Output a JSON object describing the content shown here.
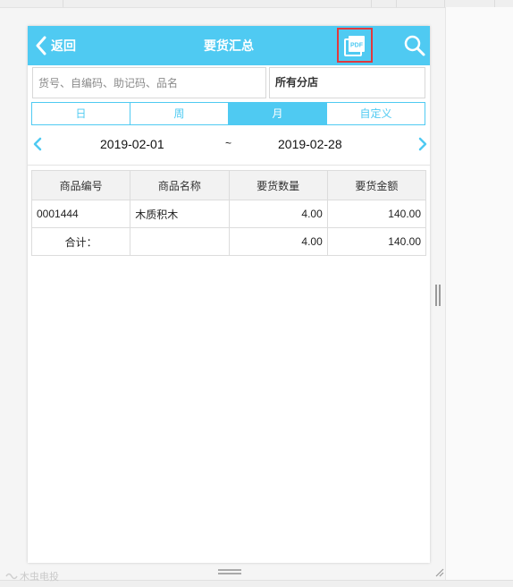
{
  "header": {
    "back_label": "返回",
    "title": "要货汇总",
    "pdf_icon": "pdf-export-icon",
    "search_icon": "search-icon",
    "pdf_text": "PDF"
  },
  "filters": {
    "search_placeholder": "货号、自编码、助记码、品名",
    "search_value": "",
    "store_value": "所有分店"
  },
  "period_tabs": [
    {
      "label": "日",
      "active": false
    },
    {
      "label": "周",
      "active": false
    },
    {
      "label": "月",
      "active": true
    },
    {
      "label": "自定义",
      "active": false
    }
  ],
  "date_range": {
    "start": "2019-02-01",
    "separator": "~",
    "end": "2019-02-28"
  },
  "table": {
    "columns": [
      "商品编号",
      "商品名称",
      "要货数量",
      "要货金额"
    ],
    "rows": [
      {
        "code": "0001444",
        "name": "木质积木",
        "qty": "4.00",
        "amount": "140.00"
      }
    ],
    "total": {
      "label": "合计：",
      "name": "",
      "qty": "4.00",
      "amount": "140.00"
    }
  },
  "watermark": "木虫电投",
  "colors": {
    "accent": "#4fcaf2",
    "highlight_border": "#e0393e"
  }
}
